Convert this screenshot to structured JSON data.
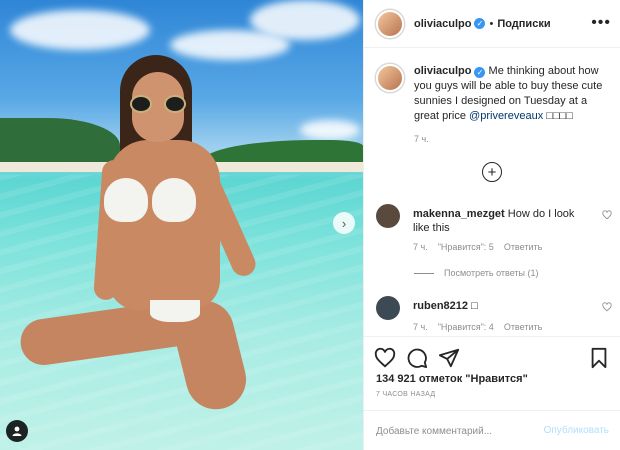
{
  "post": {
    "author": "oliviaculpo",
    "follow_label": "Подписки",
    "more_icon": "more-horizontal-icon",
    "caption_text": "Me thinking about how you guys will be able to buy these cute sunnies I designed on Tuesday at a great price",
    "caption_mention": "@privereveaux",
    "caption_emoji": "□□□□",
    "caption_time": "7 ч.",
    "load_more_icon": "plus-circle-icon"
  },
  "comments": [
    {
      "username": "makenna_mezget",
      "text": "How do I look like this",
      "time": "7 ч.",
      "likes": "\"Нравится\": 5",
      "reply": "Ответить",
      "avatar_color": "#5a4a3e"
    },
    {
      "username": "ruben8212",
      "text": "□",
      "time": "7 ч.",
      "likes": "\"Нравится\": 4",
      "reply": "Ответить",
      "avatar_color": "#3c4a56"
    }
  ],
  "view_replies": "Посмотреть ответы (1)",
  "actions": {
    "like_icon": "heart-icon",
    "comment_icon": "comment-icon",
    "share_icon": "share-icon",
    "save_icon": "bookmark-icon"
  },
  "likes_count": "134 921 отметок \"Нравится\"",
  "posted_ago": "7 ЧАСОВ НАЗАД",
  "add_comment": {
    "placeholder": "Добавьте комментарий...",
    "publish_label": "Опубликовать"
  },
  "colors": {
    "verified": "#3897f0",
    "mention": "#00376b",
    "publish_disabled": "#b2dffc",
    "muted": "#8e8e8e"
  }
}
